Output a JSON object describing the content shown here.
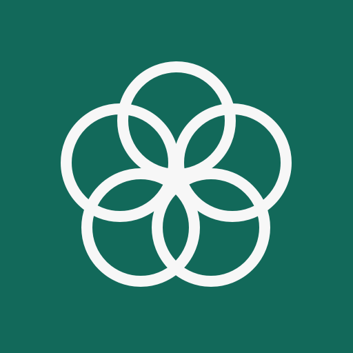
{
  "app_icon": {
    "name": "flower-of-rings-logo",
    "icon": "five-overlapping-circles-icon",
    "colors": {
      "background": "#12695A",
      "foreground": "#F7F7F7"
    },
    "ring_count": 5
  }
}
